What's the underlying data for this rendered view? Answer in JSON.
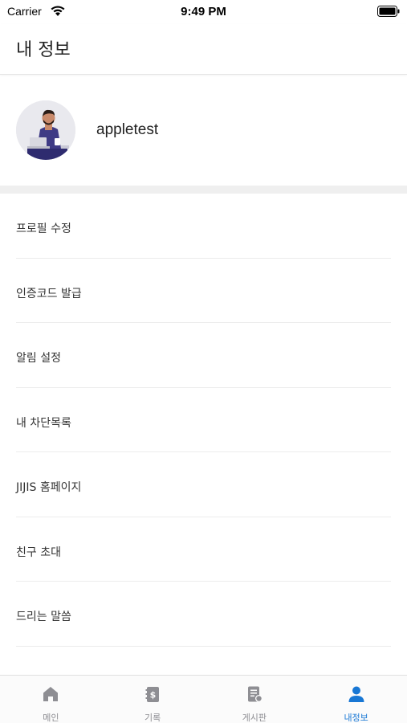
{
  "status_bar": {
    "carrier": "Carrier",
    "time": "9:49 PM"
  },
  "header": {
    "title": "내 정보"
  },
  "profile": {
    "username": "appletest",
    "avatar_icon": "user-avatar-illustration"
  },
  "menu": {
    "items": [
      {
        "label": "프로필 수정"
      },
      {
        "label": "인증코드 발급"
      },
      {
        "label": "알림 설정"
      },
      {
        "label": "내 차단목록"
      },
      {
        "label": "JIJIS 홈페이지"
      },
      {
        "label": "친구 초대"
      },
      {
        "label": "드리는 말씀"
      }
    ]
  },
  "tab_bar": {
    "active_color": "#1877d4",
    "inactive_color": "#8e8e93",
    "tabs": [
      {
        "label": "메인",
        "icon": "home-icon",
        "active": false
      },
      {
        "label": "기록",
        "icon": "record-icon",
        "active": false
      },
      {
        "label": "게시판",
        "icon": "board-icon",
        "active": false
      },
      {
        "label": "내정보",
        "icon": "person-icon",
        "active": true
      }
    ]
  }
}
